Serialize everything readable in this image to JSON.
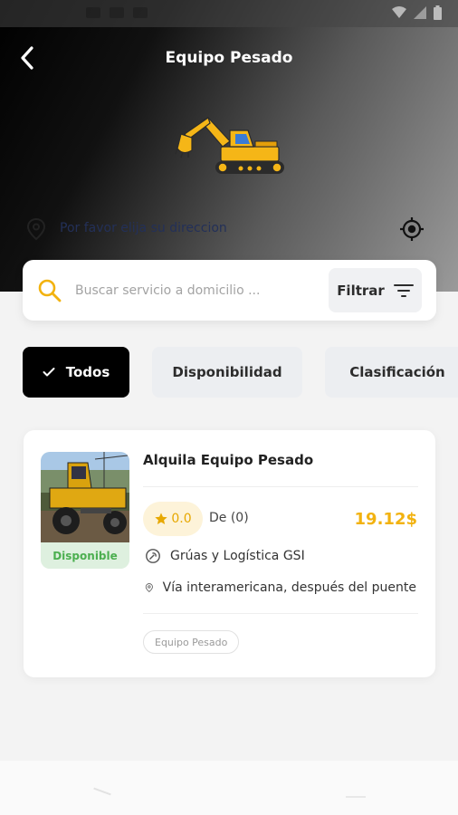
{
  "header": {
    "title": "Equipo Pesado",
    "back_icon": "chevron-left-icon",
    "gradient_colors": [
      "#000000",
      "#9a9a9a"
    ]
  },
  "status_bar": {
    "icons": [
      "wifi-icon",
      "signal-icon",
      "battery-icon"
    ]
  },
  "location": {
    "placeholder": "Por favor elija su direccion",
    "pin_icon": "location-pin-icon",
    "locate_icon": "crosshair-icon"
  },
  "search": {
    "placeholder": "Buscar servicio a domicilio ...",
    "filter_label": "Filtrar",
    "accent_color": "#f2b20f"
  },
  "chips": [
    {
      "label": "Todos",
      "active": true
    },
    {
      "label": "Disponibilidad",
      "active": false
    },
    {
      "label": "Clasificación",
      "active": false
    }
  ],
  "service_card": {
    "title": "Alquila Equipo Pesado",
    "status": "Disponible",
    "rating": "0.0",
    "reviews": "De (0)",
    "price": "19.12$",
    "provider": "Grúas y Logística GSI",
    "address": "Vía interamericana, después del puente",
    "tag": "Equipo Pesado"
  },
  "colors": {
    "price": "#f2b20f",
    "available": "#4caf50",
    "active_chip": "#000000"
  }
}
